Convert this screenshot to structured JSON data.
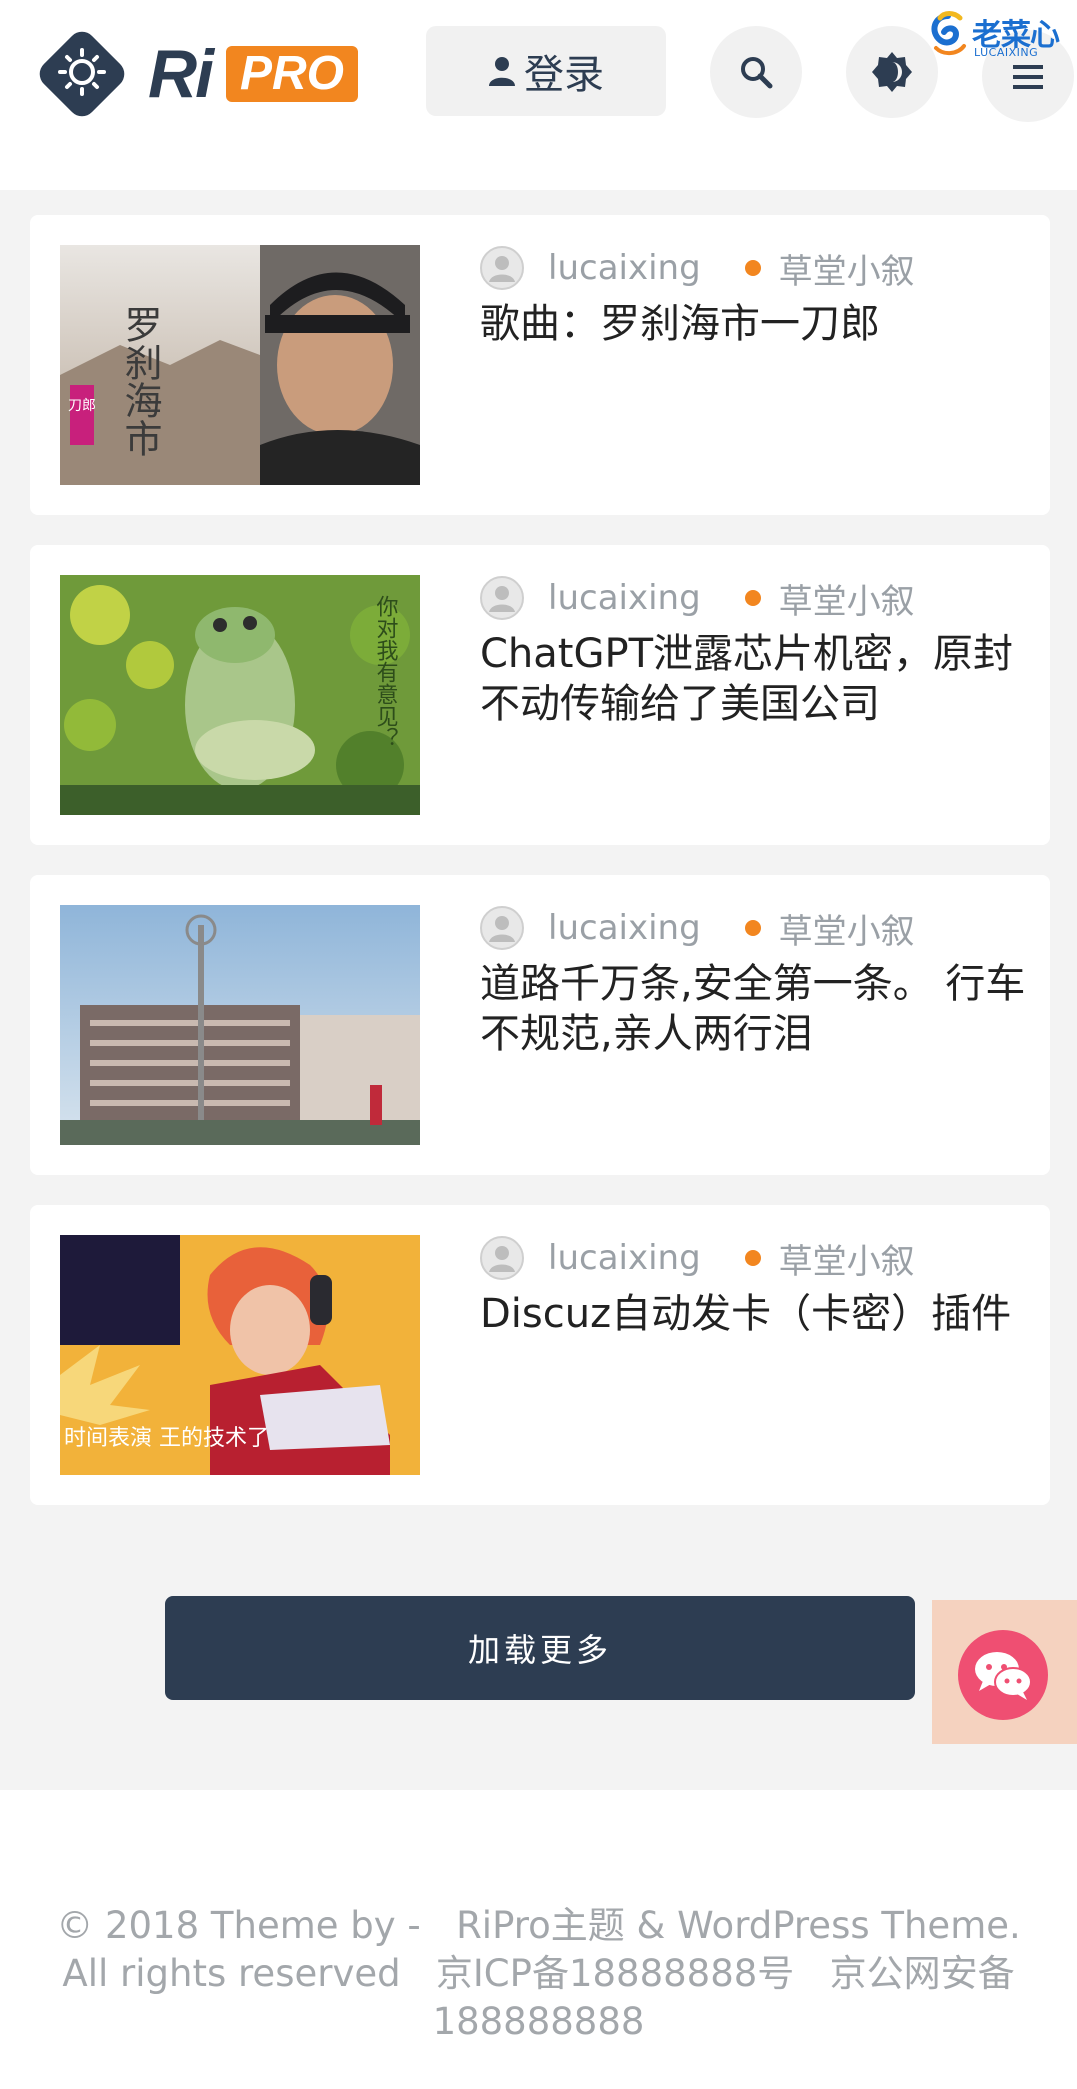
{
  "header": {
    "logo_ri": "Ri",
    "logo_pro": "PRO",
    "login_label": "登录",
    "brand_cn": "老菜心",
    "brand_en": "LUCAIXING",
    "icons": [
      "user-icon",
      "search-icon",
      "theme-toggle-icon",
      "menu-icon"
    ]
  },
  "posts": [
    {
      "author": "lucaixing",
      "category": "草堂小叙",
      "title": "歌曲：罗刹海市一刀郎",
      "thumb_text": "罗刹海市",
      "thumb_tag": "刀郎"
    },
    {
      "author": "lucaixing",
      "category": "草堂小叙",
      "title": "ChatGPT泄露芯片机密，原封不动传输给了美国公司",
      "thumb_text": "你对我有意见？"
    },
    {
      "author": "lucaixing",
      "category": "草堂小叙",
      "title": "道路千万条,安全第一条。 行车不规范,亲人两行泪"
    },
    {
      "author": "lucaixing",
      "category": "草堂小叙",
      "title": "Discuz自动发卡（卡密）插件",
      "thumb_text": "时间表演 王的技术了"
    }
  ],
  "load_more": "加载更多",
  "footer": {
    "line_a": "© 2018 Theme by -",
    "line_b": "RiPro主题 & WordPress Theme. All rights reserved",
    "line_c": "京ICP备18888888号",
    "line_d": "京公网安备188888888"
  },
  "colors": {
    "accent": "#f2861f",
    "dark": "#2d3d52",
    "chat": "#ef4f72"
  }
}
